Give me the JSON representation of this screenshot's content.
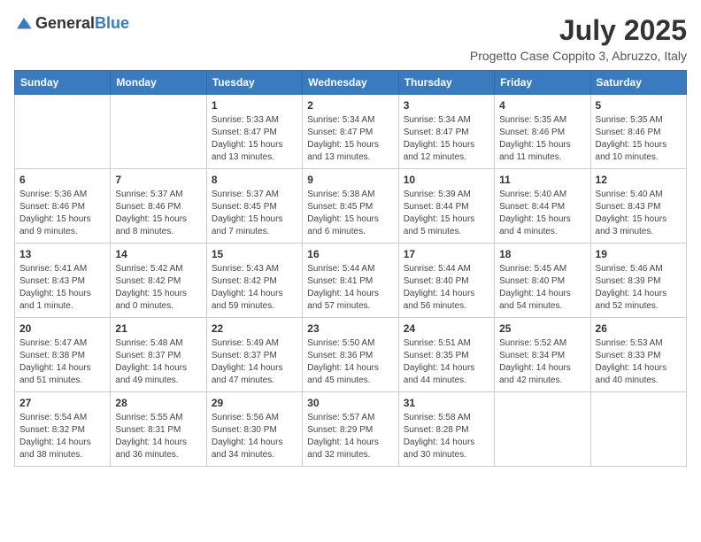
{
  "header": {
    "logo": {
      "general": "General",
      "blue": "Blue"
    },
    "month_year": "July 2025",
    "subtitle": "Progetto Case Coppito 3, Abruzzo, Italy"
  },
  "weekdays": [
    "Sunday",
    "Monday",
    "Tuesday",
    "Wednesday",
    "Thursday",
    "Friday",
    "Saturday"
  ],
  "weeks": [
    [
      {
        "day": "",
        "sunrise": "",
        "sunset": "",
        "daylight": ""
      },
      {
        "day": "",
        "sunrise": "",
        "sunset": "",
        "daylight": ""
      },
      {
        "day": "1",
        "sunrise": "Sunrise: 5:33 AM",
        "sunset": "Sunset: 8:47 PM",
        "daylight": "Daylight: 15 hours and 13 minutes."
      },
      {
        "day": "2",
        "sunrise": "Sunrise: 5:34 AM",
        "sunset": "Sunset: 8:47 PM",
        "daylight": "Daylight: 15 hours and 13 minutes."
      },
      {
        "day": "3",
        "sunrise": "Sunrise: 5:34 AM",
        "sunset": "Sunset: 8:47 PM",
        "daylight": "Daylight: 15 hours and 12 minutes."
      },
      {
        "day": "4",
        "sunrise": "Sunrise: 5:35 AM",
        "sunset": "Sunset: 8:46 PM",
        "daylight": "Daylight: 15 hours and 11 minutes."
      },
      {
        "day": "5",
        "sunrise": "Sunrise: 5:35 AM",
        "sunset": "Sunset: 8:46 PM",
        "daylight": "Daylight: 15 hours and 10 minutes."
      }
    ],
    [
      {
        "day": "6",
        "sunrise": "Sunrise: 5:36 AM",
        "sunset": "Sunset: 8:46 PM",
        "daylight": "Daylight: 15 hours and 9 minutes."
      },
      {
        "day": "7",
        "sunrise": "Sunrise: 5:37 AM",
        "sunset": "Sunset: 8:46 PM",
        "daylight": "Daylight: 15 hours and 8 minutes."
      },
      {
        "day": "8",
        "sunrise": "Sunrise: 5:37 AM",
        "sunset": "Sunset: 8:45 PM",
        "daylight": "Daylight: 15 hours and 7 minutes."
      },
      {
        "day": "9",
        "sunrise": "Sunrise: 5:38 AM",
        "sunset": "Sunset: 8:45 PM",
        "daylight": "Daylight: 15 hours and 6 minutes."
      },
      {
        "day": "10",
        "sunrise": "Sunrise: 5:39 AM",
        "sunset": "Sunset: 8:44 PM",
        "daylight": "Daylight: 15 hours and 5 minutes."
      },
      {
        "day": "11",
        "sunrise": "Sunrise: 5:40 AM",
        "sunset": "Sunset: 8:44 PM",
        "daylight": "Daylight: 15 hours and 4 minutes."
      },
      {
        "day": "12",
        "sunrise": "Sunrise: 5:40 AM",
        "sunset": "Sunset: 8:43 PM",
        "daylight": "Daylight: 15 hours and 3 minutes."
      }
    ],
    [
      {
        "day": "13",
        "sunrise": "Sunrise: 5:41 AM",
        "sunset": "Sunset: 8:43 PM",
        "daylight": "Daylight: 15 hours and 1 minute."
      },
      {
        "day": "14",
        "sunrise": "Sunrise: 5:42 AM",
        "sunset": "Sunset: 8:42 PM",
        "daylight": "Daylight: 15 hours and 0 minutes."
      },
      {
        "day": "15",
        "sunrise": "Sunrise: 5:43 AM",
        "sunset": "Sunset: 8:42 PM",
        "daylight": "Daylight: 14 hours and 59 minutes."
      },
      {
        "day": "16",
        "sunrise": "Sunrise: 5:44 AM",
        "sunset": "Sunset: 8:41 PM",
        "daylight": "Daylight: 14 hours and 57 minutes."
      },
      {
        "day": "17",
        "sunrise": "Sunrise: 5:44 AM",
        "sunset": "Sunset: 8:40 PM",
        "daylight": "Daylight: 14 hours and 56 minutes."
      },
      {
        "day": "18",
        "sunrise": "Sunrise: 5:45 AM",
        "sunset": "Sunset: 8:40 PM",
        "daylight": "Daylight: 14 hours and 54 minutes."
      },
      {
        "day": "19",
        "sunrise": "Sunrise: 5:46 AM",
        "sunset": "Sunset: 8:39 PM",
        "daylight": "Daylight: 14 hours and 52 minutes."
      }
    ],
    [
      {
        "day": "20",
        "sunrise": "Sunrise: 5:47 AM",
        "sunset": "Sunset: 8:38 PM",
        "daylight": "Daylight: 14 hours and 51 minutes."
      },
      {
        "day": "21",
        "sunrise": "Sunrise: 5:48 AM",
        "sunset": "Sunset: 8:37 PM",
        "daylight": "Daylight: 14 hours and 49 minutes."
      },
      {
        "day": "22",
        "sunrise": "Sunrise: 5:49 AM",
        "sunset": "Sunset: 8:37 PM",
        "daylight": "Daylight: 14 hours and 47 minutes."
      },
      {
        "day": "23",
        "sunrise": "Sunrise: 5:50 AM",
        "sunset": "Sunset: 8:36 PM",
        "daylight": "Daylight: 14 hours and 45 minutes."
      },
      {
        "day": "24",
        "sunrise": "Sunrise: 5:51 AM",
        "sunset": "Sunset: 8:35 PM",
        "daylight": "Daylight: 14 hours and 44 minutes."
      },
      {
        "day": "25",
        "sunrise": "Sunrise: 5:52 AM",
        "sunset": "Sunset: 8:34 PM",
        "daylight": "Daylight: 14 hours and 42 minutes."
      },
      {
        "day": "26",
        "sunrise": "Sunrise: 5:53 AM",
        "sunset": "Sunset: 8:33 PM",
        "daylight": "Daylight: 14 hours and 40 minutes."
      }
    ],
    [
      {
        "day": "27",
        "sunrise": "Sunrise: 5:54 AM",
        "sunset": "Sunset: 8:32 PM",
        "daylight": "Daylight: 14 hours and 38 minutes."
      },
      {
        "day": "28",
        "sunrise": "Sunrise: 5:55 AM",
        "sunset": "Sunset: 8:31 PM",
        "daylight": "Daylight: 14 hours and 36 minutes."
      },
      {
        "day": "29",
        "sunrise": "Sunrise: 5:56 AM",
        "sunset": "Sunset: 8:30 PM",
        "daylight": "Daylight: 14 hours and 34 minutes."
      },
      {
        "day": "30",
        "sunrise": "Sunrise: 5:57 AM",
        "sunset": "Sunset: 8:29 PM",
        "daylight": "Daylight: 14 hours and 32 minutes."
      },
      {
        "day": "31",
        "sunrise": "Sunrise: 5:58 AM",
        "sunset": "Sunset: 8:28 PM",
        "daylight": "Daylight: 14 hours and 30 minutes."
      },
      {
        "day": "",
        "sunrise": "",
        "sunset": "",
        "daylight": ""
      },
      {
        "day": "",
        "sunrise": "",
        "sunset": "",
        "daylight": ""
      }
    ]
  ]
}
